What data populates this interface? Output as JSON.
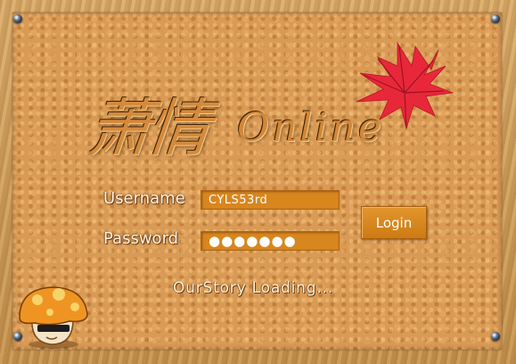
{
  "logo": {
    "title_cjk": "萧情",
    "title_latin": "Online",
    "emblem": "maple-leaf-icon",
    "emblem_color": "#e8283a"
  },
  "login_form": {
    "username_label": "Username",
    "username_value": "CYLS53rd",
    "password_label": "Password",
    "password_value": "●●●●●●●",
    "login_button_label": "Login"
  },
  "status": {
    "text": "OurStory  Loading..."
  },
  "decor": {
    "mascot": "orange-mushroom-icon",
    "pins": "pushpin-icon"
  },
  "colors": {
    "board": "#d99a55",
    "field": "#d8861e",
    "button": "#d98a22",
    "frame": "#c89a5a"
  }
}
